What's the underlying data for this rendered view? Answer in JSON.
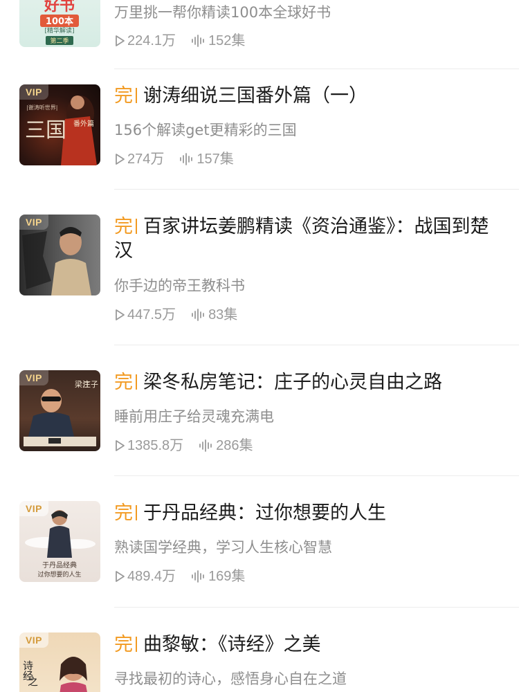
{
  "items": [
    {
      "vip": "",
      "tag": "",
      "title": "",
      "desc": "万里挑一帮你精读100本全球好书",
      "plays": "224.1万",
      "episodes": "152集",
      "cover_text": [
        "好书",
        "100本",
        "[精华解读]",
        "第二季"
      ]
    },
    {
      "vip": "VIP",
      "tag": "完",
      "title": "谢涛细说三国番外篇（一）",
      "desc": "156个解读get更精彩的三国",
      "plays": "274万",
      "episodes": "157集",
      "cover_text": [
        "|谢涛听世界|",
        "三国",
        "番外篇"
      ]
    },
    {
      "vip": "VIP",
      "tag": "完",
      "title": "百家讲坛姜鹏精读《资治通鉴》：战国到楚汉",
      "desc": "你手边的帝王教科书",
      "plays": "447.5万",
      "episodes": "83集",
      "cover_text": []
    },
    {
      "vip": "VIP",
      "tag": "完",
      "title": "梁冬私房笔记：庄子的心灵自由之路",
      "desc": "睡前用庄子给灵魂充满电",
      "plays": "1385.8万",
      "episodes": "286集",
      "cover_text": [
        "梁注",
        "庄子"
      ]
    },
    {
      "vip": "VIP",
      "tag": "完",
      "title": "于丹品经典：过你想要的人生",
      "desc": "熟读国学经典，学习人生核心智慧",
      "plays": "489.4万",
      "episodes": "169集",
      "cover_text": [
        "于丹品经典",
        "过你想要的人生"
      ]
    },
    {
      "vip": "VIP",
      "tag": "完",
      "title": "曲黎敏：《诗经》之美",
      "desc": "寻找最初的诗心，感悟身心自在之道",
      "plays": "",
      "episodes": "",
      "cover_text": [
        "诗经",
        "之"
      ]
    }
  ],
  "icons": {
    "play": "play-triangle-icon",
    "episodes": "audio-wave-icon"
  },
  "colors": {
    "tag": "#f29a21",
    "vip": "#f5d48c",
    "title": "#1b1b1b",
    "desc": "#8e8e8e",
    "divider": "#ececec"
  }
}
